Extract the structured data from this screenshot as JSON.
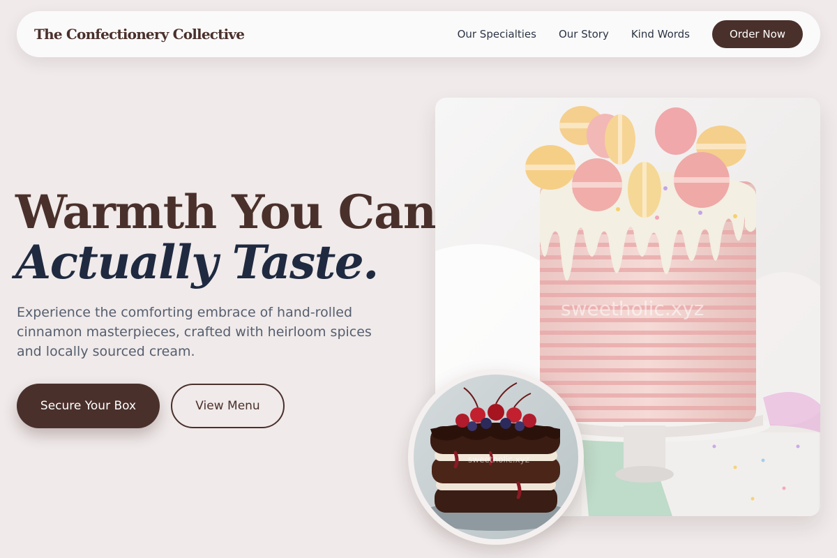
{
  "nav": {
    "brand": "The Confectionery Collective",
    "links": [
      "Our Specialties",
      "Our Story",
      "Kind Words"
    ],
    "cta": "Order Now"
  },
  "hero": {
    "title_line1": "Warmth You Can",
    "title_line2": "Actually Taste.",
    "subtitle": "Experience the comforting embrace of hand-rolled cinnamon masterpieces, crafted with heirloom spices and locally sourced cream.",
    "primary_button": "Secure Your Box",
    "secondary_button": "View Menu"
  },
  "images": {
    "main_watermark": "sweetholic.xyz",
    "thumb_watermark": "sweetholic.xyz"
  },
  "colors": {
    "brand": "#4a302b",
    "navy": "#1f2a40",
    "background": "#f0eaea"
  }
}
